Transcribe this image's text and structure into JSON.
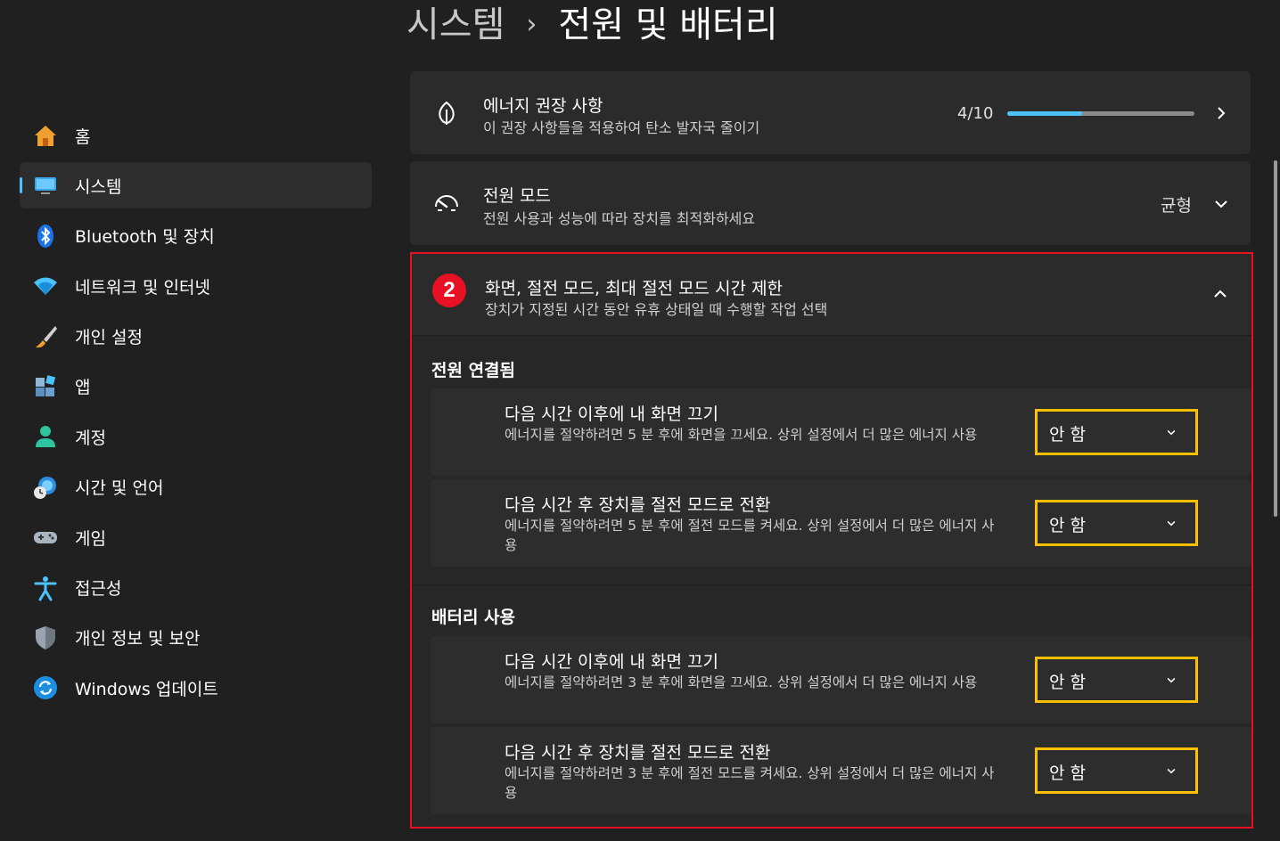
{
  "breadcrumb": {
    "parent": "시스템",
    "separator": "›",
    "current": "전원 및 배터리"
  },
  "sidebar": {
    "items": [
      {
        "label": "홈",
        "icon": "home-icon"
      },
      {
        "label": "시스템",
        "icon": "monitor-icon",
        "active": true
      },
      {
        "label": "Bluetooth 및 장치",
        "icon": "bluetooth-icon"
      },
      {
        "label": "네트워크 및 인터넷",
        "icon": "wifi-icon"
      },
      {
        "label": "개인 설정",
        "icon": "paintbrush-icon"
      },
      {
        "label": "앱",
        "icon": "apps-icon"
      },
      {
        "label": "계정",
        "icon": "person-icon"
      },
      {
        "label": "시간 및 언어",
        "icon": "globe-clock-icon"
      },
      {
        "label": "게임",
        "icon": "gamepad-icon"
      },
      {
        "label": "접근성",
        "icon": "accessibility-icon"
      },
      {
        "label": "개인 정보 및 보안",
        "icon": "shield-icon"
      },
      {
        "label": "Windows 업데이트",
        "icon": "update-icon"
      }
    ]
  },
  "energy": {
    "title": "에너지 권장 사항",
    "subtitle": "이 권장 사항들을 적용하여 탄소 발자국 줄이기",
    "progress_text": "4/10",
    "progress_fraction": 0.4
  },
  "power_mode": {
    "title": "전원 모드",
    "subtitle": "전원 사용과 성능에 따라 장치를 최적화하세요",
    "value": "균형"
  },
  "screen_sleep": {
    "badge": "2",
    "title": "화면, 절전 모드, 최대 절전 모드 시간 제한",
    "subtitle": "장치가 지정된 시간 동안 유휴 상태일 때 수행할 작업 선택",
    "groups": [
      {
        "title": "전원 연결됨",
        "rows": [
          {
            "title": "다음 시간 이후에 내 화면 끄기",
            "desc": "에너지를 절약하려면 5 분 후에 화면을 끄세요. 상위 설정에서 더 많은 에너지 사용",
            "value": "안 함"
          },
          {
            "title": "다음 시간 후 장치를 절전 모드로 전환",
            "desc": "에너지를 절약하려면 5 분 후에 절전 모드를 켜세요. 상위 설정에서 더 많은 에너지 사용",
            "value": "안 함"
          }
        ]
      },
      {
        "title": "배터리 사용",
        "rows": [
          {
            "title": "다음 시간 이후에 내 화면 끄기",
            "desc": "에너지를 절약하려면 3 분 후에 화면을 끄세요. 상위 설정에서 더 많은 에너지 사용",
            "value": "안 함"
          },
          {
            "title": "다음 시간 후 장치를 절전 모드로 전환",
            "desc": "에너지를 절약하려면 3 분 후에 절전 모드를 켜세요. 상위 설정에서 더 많은 에너지 사용",
            "value": "안 함"
          }
        ]
      }
    ]
  },
  "colors": {
    "accent": "#4cc2ff",
    "highlight_box": "#e81123",
    "dropdown_highlight": "#ffc000"
  }
}
